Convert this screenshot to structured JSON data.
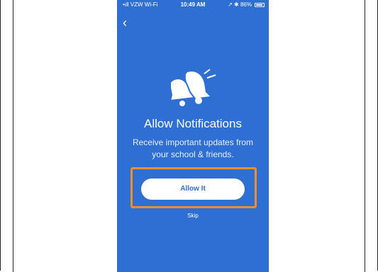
{
  "status_bar": {
    "carrier": "•ıll VZW Wi-Fi",
    "time": "10:49 AM",
    "right": "↗ ✱ 86%"
  },
  "screen": {
    "title": "Allow Notifications",
    "subtitle": "Receive important updates from your school & friends.",
    "primary_button": "Allow It",
    "skip_link": "Skip"
  },
  "colors": {
    "background": "#2f6fd4",
    "highlight": "#f08f2a"
  },
  "icons": {
    "back": "chevron-left-icon",
    "hero": "bells-icon"
  }
}
